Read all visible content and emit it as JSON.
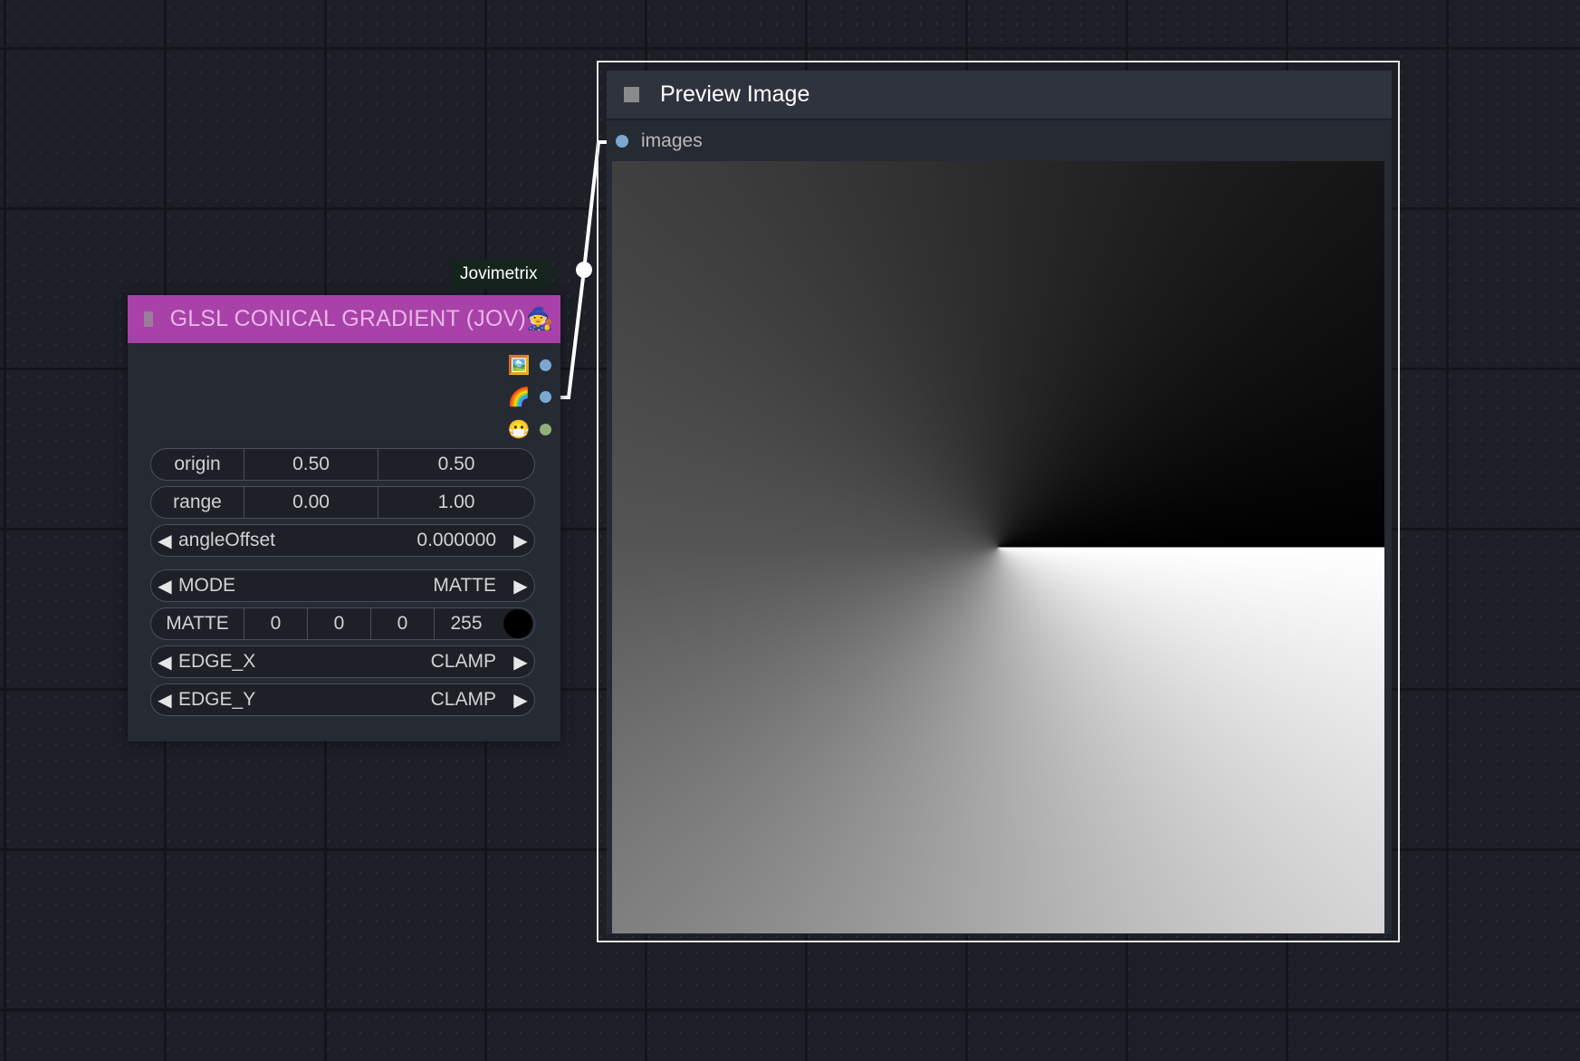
{
  "gradient_node": {
    "title": "GLSL CONICAL GRADIENT (JOV)",
    "badge": "Jovimetrix",
    "title_icon": "🧙",
    "outputs": [
      {
        "icon": "🖼️",
        "icon_name": "image-output-icon",
        "color": "#7aa8d0"
      },
      {
        "icon": "🌈",
        "icon_name": "rgb-output-icon",
        "color": "#7aa8d0"
      },
      {
        "icon": "😷",
        "icon_name": "mask-output-icon",
        "color": "#8fb07a"
      }
    ],
    "origin": {
      "label": "origin",
      "x": "0.50",
      "y": "0.50"
    },
    "range": {
      "label": "range",
      "min": "0.00",
      "max": "1.00"
    },
    "angle_offset": {
      "label": "angleOffset",
      "value": "0.000000"
    },
    "mode": {
      "label": "MODE",
      "value": "MATTE"
    },
    "matte": {
      "label": "MATTE",
      "r": "0",
      "g": "0",
      "b": "0",
      "a": "255",
      "swatch_color": "#000000"
    },
    "edge_x": {
      "label": "EDGE_X",
      "value": "CLAMP"
    },
    "edge_y": {
      "label": "EDGE_Y",
      "value": "CLAMP"
    }
  },
  "preview_node": {
    "title": "Preview Image",
    "input_label": "images"
  },
  "colors": {
    "node_title_purple": "#a841a8",
    "link": "#ffffff",
    "canvas": "#1c1f26"
  }
}
